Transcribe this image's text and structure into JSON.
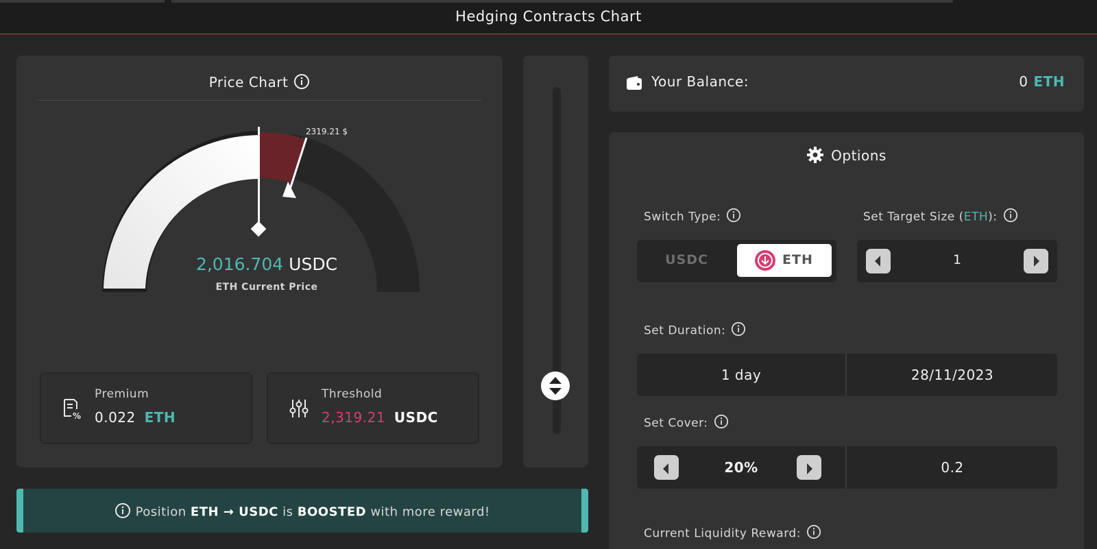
{
  "header": {
    "title": "Hedging Contracts Chart"
  },
  "price_chart": {
    "title": "Price Chart",
    "marker_price": "2319.21 $",
    "current_price_value": "2,016.704",
    "current_price_unit": "USDC",
    "current_price_label": "ETH Current Price",
    "premium": {
      "label": "Premium",
      "value": "0.022",
      "unit": "ETH"
    },
    "threshold": {
      "label": "Threshold",
      "value": "2,319.21",
      "unit": "USDC"
    }
  },
  "banner": {
    "prefix": "Position",
    "pair": "ETH → USDC",
    "middle": "is",
    "highlight": "BOOSTED",
    "suffix": "with more reward!"
  },
  "balance": {
    "label": "Your Balance:",
    "amount": "0",
    "unit": "ETH"
  },
  "options": {
    "title": "Options",
    "switch_type": {
      "label": "Switch Type:",
      "option_a": "USDC",
      "option_b": "ETH",
      "selected": "ETH"
    },
    "target_size": {
      "label_prefix": "Set Target Size (",
      "label_unit": "ETH",
      "label_suffix": "):",
      "value": "1"
    },
    "duration": {
      "label": "Set Duration:",
      "period": "1 day",
      "date": "28/11/2023"
    },
    "cover": {
      "label": "Set Cover:",
      "percent": "20%",
      "value": "0.2"
    },
    "liquidity_reward": {
      "label": "Current Liquidity Reward:"
    }
  },
  "colors": {
    "accent_teal": "#4fb8b0",
    "accent_pink": "#d63c74",
    "gauge_highlight": "#6a2328"
  }
}
